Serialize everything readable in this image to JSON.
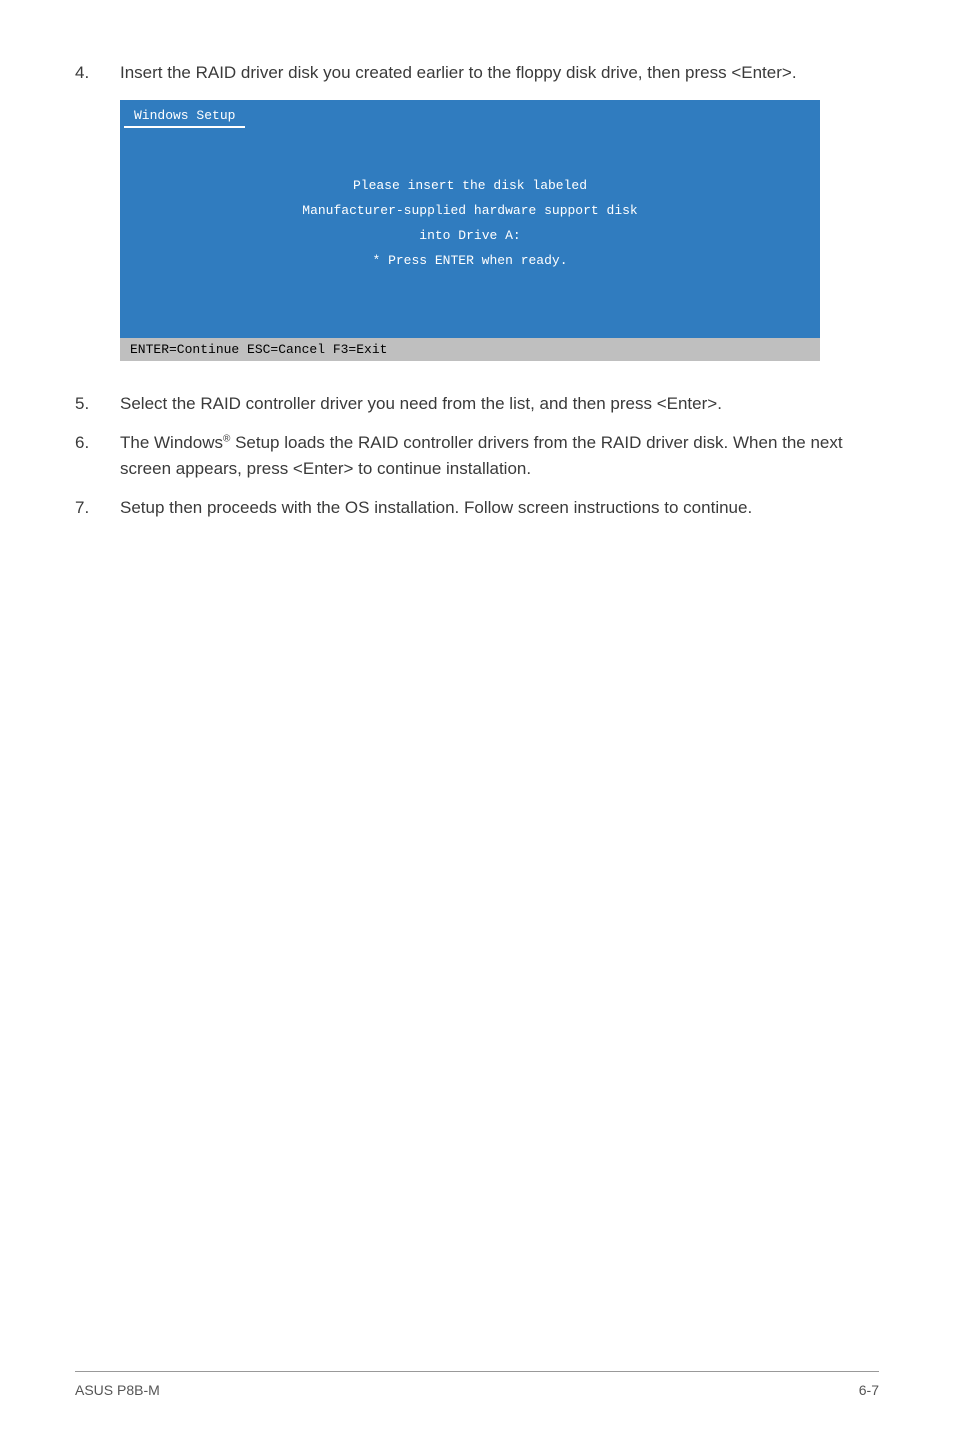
{
  "step4": {
    "num": "4.",
    "text": "Insert the RAID driver disk you created earlier to the floppy disk drive, then press <Enter>."
  },
  "windows_setup": {
    "title": "Windows Setup",
    "line1": "Please insert the disk labeled",
    "line2": "Manufacturer-supplied hardware support disk",
    "line3": "into Drive A:",
    "line4": "*  Press ENTER when ready.",
    "footer": "  ENTER=Continue   ESC=Cancel   F3=Exit"
  },
  "step5": {
    "num": "5.",
    "text": "Select the RAID controller driver you need from the list, and then press <Enter>."
  },
  "step6": {
    "num": "6.",
    "text_pre": "The Windows",
    "sup": "®",
    "text_post": " Setup loads the RAID controller drivers from the RAID driver disk. When the next screen appears, press <Enter> to continue installation."
  },
  "step7": {
    "num": "7.",
    "text": "Setup then proceeds with the OS installation. Follow screen instructions to continue."
  },
  "footer": {
    "left": "ASUS P8B-M",
    "right": "6-7"
  }
}
